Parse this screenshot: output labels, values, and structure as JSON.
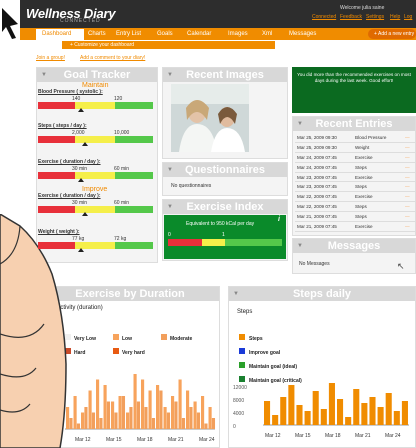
{
  "app": {
    "logo": "Wellness Diary",
    "logo_sub": "CONNECTED",
    "welcome": "Welcome julia saine",
    "top_links": [
      "Connected",
      "Feedback",
      "Settings",
      "Help",
      "Log"
    ]
  },
  "nav": {
    "tabs": [
      "Dashboard",
      "Charts",
      "Entry List",
      "Goals",
      "Calendar",
      "Images",
      "Xml",
      "Messages"
    ],
    "active": "Dashboard",
    "add_new": "+ Add a new entry"
  },
  "subbar": "+ Customize your dashboard",
  "links": {
    "join_group": "Join a group!",
    "add_comment": "Add a comment to your diary!"
  },
  "goal_tracker": {
    "title": "Goal Tracker",
    "items": [
      {
        "status": "Maintain",
        "name": "Blood Pressure ( systolic ):",
        "lo": "140",
        "hi": "120"
      },
      {
        "status": "",
        "name": "Steps ( steps / day ):",
        "lo": "2,000",
        "hi": "10,000"
      },
      {
        "status": "",
        "name": "Exercise ( duration / day ):",
        "lo": "30 min",
        "hi": "60 min"
      },
      {
        "status": "Improve",
        "name": "Exercise ( duration / day ):",
        "lo": "30 min",
        "hi": "60 min"
      },
      {
        "status": "",
        "name": "Weight ( weight ):",
        "lo": "77 kg",
        "hi": "72 kg"
      }
    ]
  },
  "recent_images": {
    "title": "Recent Images"
  },
  "questionnaires": {
    "title": "Questionnaires",
    "empty": "No questionnaires"
  },
  "exercise_index": {
    "title": "Exercise Index",
    "desc": "Equivalent to 950 kCal per day",
    "scale_lo": "0",
    "scale_hi": "1",
    "info": "i"
  },
  "alert": {
    "text": "You did more than the recommended exercises on most days during the last week. Good effort!"
  },
  "recent_entries": {
    "title": "Recent Entries",
    "rows": [
      {
        "date": "Mar 25, 2009 09:30",
        "type": "Blood Pressure"
      },
      {
        "date": "Mar 25, 2009 09:30",
        "type": "Weight"
      },
      {
        "date": "Mar 24, 2009 07:45",
        "type": "Exercise"
      },
      {
        "date": "Mar 24, 2009 07:45",
        "type": "Steps"
      },
      {
        "date": "Mar 23, 2009 07:45",
        "type": "Exercise"
      },
      {
        "date": "Mar 23, 2009 07:45",
        "type": "Steps"
      },
      {
        "date": "Mar 22, 2009 07:45",
        "type": "Exercise"
      },
      {
        "date": "Mar 22, 2009 07:45",
        "type": "Steps"
      },
      {
        "date": "Mar 21, 2009 07:45",
        "type": "Steps"
      },
      {
        "date": "Mar 21, 2009 07:45",
        "type": "Exercise"
      }
    ]
  },
  "messages": {
    "title": "Messages",
    "empty": "No Messages"
  },
  "colors": {
    "orange": "#f08c00",
    "green": "#0b6a20",
    "red": "#e8303a",
    "yellow": "#f5ef4a",
    "lightgreen": "#54c84a"
  },
  "chart_data": [
    {
      "type": "bar",
      "title": "Exercise by Duration",
      "subtitle": "se activity (duration)",
      "legend": [
        "Very Low",
        "Low",
        "Moderate",
        "Hard",
        "Very hard"
      ],
      "x_ticks": [
        "Mar 12",
        "Mar 15",
        "Mar 18",
        "Mar 21",
        "Mar 24"
      ],
      "y_ticks": [
        "in",
        "in",
        "in",
        "in",
        "in",
        "in"
      ],
      "series": [
        {
          "name": "Low",
          "values": [
            20,
            30,
            15,
            35,
            45,
            40,
            25,
            30,
            15,
            50,
            45,
            35,
            40,
            20,
            30,
            45,
            35,
            25,
            30,
            20
          ]
        },
        {
          "name": "Moderate",
          "values": [
            10,
            5,
            20,
            15,
            10,
            25,
            15,
            30,
            20,
            25,
            20,
            10,
            35,
            15,
            25,
            10,
            20,
            15,
            5,
            10
          ]
        }
      ]
    },
    {
      "type": "bar",
      "title": "Steps daily",
      "subtitle": "Steps",
      "legend": [
        "Steps",
        "Improve goal",
        "Maintain goal (ideal)",
        "Maintain goal (critical)"
      ],
      "x_ticks": [
        "Mar 12",
        "Mar 15",
        "Mar 18",
        "Mar 21",
        "Mar 24"
      ],
      "y_ticks": [
        "12000",
        "8000",
        "4000",
        "0"
      ],
      "ylim": [
        0,
        13000
      ],
      "series": [
        {
          "name": "Steps",
          "values": [
            6000,
            2500,
            7000,
            10000,
            5000,
            3500,
            8500,
            4000,
            10500,
            6500,
            2000,
            9000,
            5500,
            7000,
            4500,
            8000,
            3500,
            6000
          ]
        }
      ]
    }
  ]
}
